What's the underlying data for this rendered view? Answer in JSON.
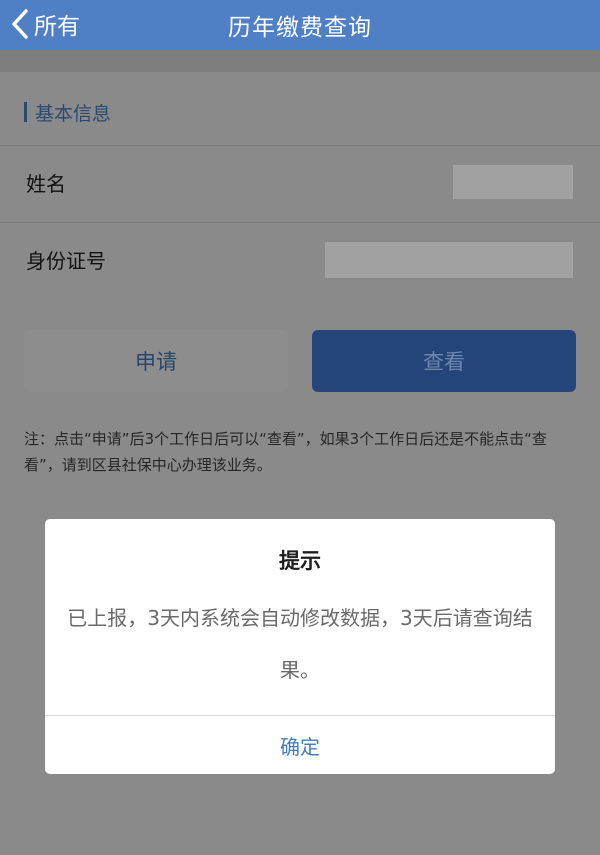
{
  "navbar": {
    "back_label": "所有",
    "title": "历年缴费查询"
  },
  "section": {
    "title": "基本信息"
  },
  "fields": [
    {
      "label": "姓名"
    },
    {
      "label": "身份证号"
    }
  ],
  "buttons": {
    "apply": "申请",
    "view": "查看"
  },
  "note": "注：点击“申请”后3个工作日后可以“查看”，如果3个工作日后还是不能点击“查看”，请到区县社保中心办理该业务。",
  "dialog": {
    "title": "提示",
    "message": "已上报，3天内系统会自动修改数据，3天后请查询结果。",
    "confirm": "确定"
  },
  "colors": {
    "navbar": "#4f7fc4",
    "accent": "#3f7fc1"
  }
}
